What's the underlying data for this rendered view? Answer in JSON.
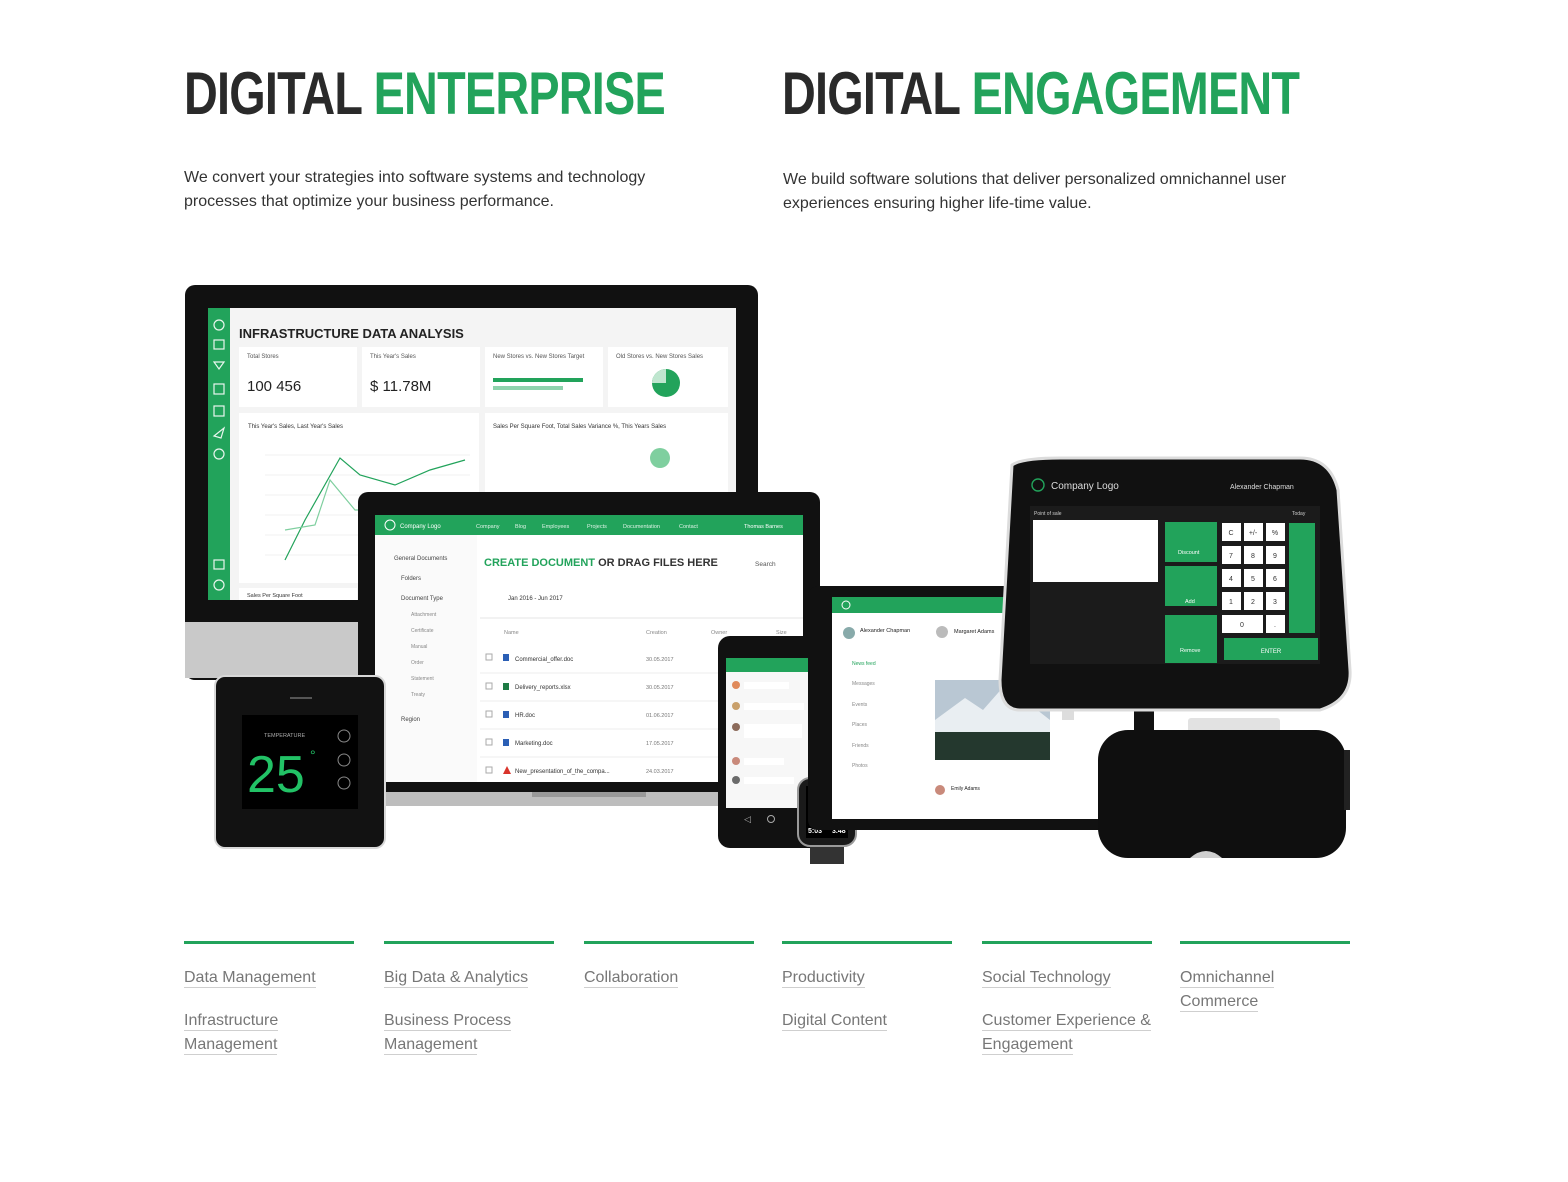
{
  "headings": {
    "left": {
      "word1": "DIGITAL",
      "word2": "ENTERPRISE",
      "description": "We convert your strategies into software systems and technology processes that optimize your business performance."
    },
    "right": {
      "word1": "DIGITAL",
      "word2": "ENGAGEMENT",
      "description": "We build software solutions that deliver personalized omnichannel user experiences ensuring higher life-time value."
    }
  },
  "desktop": {
    "title": "INFRASTRUCTURE DATA ANALYSIS",
    "cards": [
      {
        "label": "Total Stores",
        "value": "100 456"
      },
      {
        "label": "This Year's Sales",
        "value": "$ 11.78M"
      },
      {
        "label": "New Stores vs. New Stores Target"
      },
      {
        "label": "Old Stores vs. New Stores Sales"
      }
    ],
    "chart1_title": "This Year's Sales, Last Year's Sales",
    "chart2_title": "Sales Per Square Foot, Total Sales Variance %, This Years Sales",
    "footer_label": "Sales Per Square Foot"
  },
  "laptop": {
    "logo": "Company Logo",
    "nav": [
      "Company",
      "Blog",
      "Employees",
      "Projects",
      "Documentation",
      "Contact"
    ],
    "user": "Thomas Barnes",
    "sidebar": [
      "General Documents",
      "Folders",
      "Document Type",
      "Attachment",
      "Certificate",
      "Manual",
      "Order",
      "Statement",
      "Treaty",
      "Region"
    ],
    "header_a": "CREATE DOCUMENT",
    "header_b": " OR DRAG FILES HERE",
    "search": "Search",
    "period": "Jan 2016 - Jun 2017",
    "columns": [
      "Name",
      "Creation",
      "Owner",
      "Size"
    ],
    "files": [
      {
        "name": "Commercial_offer.doc",
        "date": "30.05.2017"
      },
      {
        "name": "Delivery_reports.xlsx",
        "date": "30.05.2017"
      },
      {
        "name": "HR.doc",
        "date": "01.06.2017"
      },
      {
        "name": "Marketing.doc",
        "date": "17.05.2017"
      },
      {
        "name": "New_presentation_of_the_compa...",
        "date": "24.03.2017"
      }
    ]
  },
  "thermostat": {
    "label": "TEMPERATURE",
    "value": "25",
    "unit": "°"
  },
  "watch": {
    "big": "147",
    "left": "5:03",
    "right": "3.48"
  },
  "tablet": {
    "user": "Alexander Chapman",
    "post_author": "Margaret Adams",
    "menu": [
      "News feed",
      "Messages",
      "Events",
      "Places",
      "Friends",
      "Photos"
    ],
    "comment_author": "Emily Adams"
  },
  "pos": {
    "logo": "Company Logo",
    "user": "Alexander Chapman",
    "tab": "Point of sale",
    "today": "Today",
    "actions": [
      "Discount",
      "Add",
      "Remove"
    ],
    "enter": "ENTER",
    "keys": [
      "C",
      "+/-",
      "%",
      "7",
      "8",
      "9",
      "4",
      "5",
      "6",
      "1",
      "2",
      "3",
      "0",
      "."
    ]
  },
  "columns": [
    {
      "links": [
        "Data Management",
        "Infrastructure Management"
      ]
    },
    {
      "links": [
        "Big Data & Analytics",
        "Business Process Management"
      ]
    },
    {
      "links": [
        "Collaboration"
      ]
    },
    {
      "links": [
        "Productivity",
        "Digital Content"
      ]
    },
    {
      "links": [
        "Social Technology",
        "Customer Experience & Engagement"
      ]
    },
    {
      "links": [
        "Omnichannel Commerce"
      ]
    }
  ],
  "colors": {
    "green": "#22a35b",
    "dark": "#2a2a2a"
  }
}
